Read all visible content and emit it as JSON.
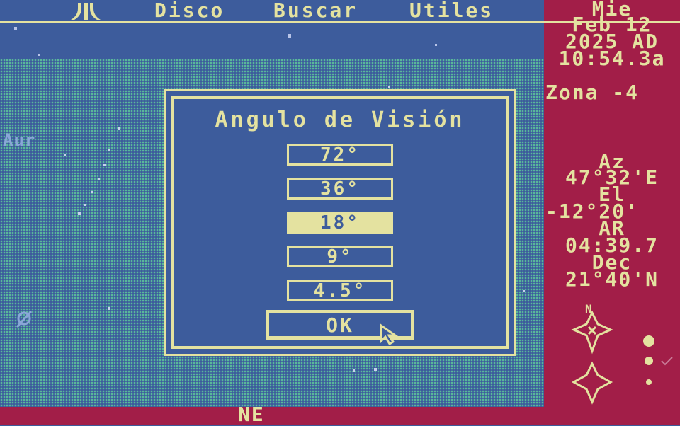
{
  "menubar": {
    "logo_icon": "atari-fuji-icon",
    "items": [
      "Disco",
      "Buscar",
      "Utiles"
    ]
  },
  "sidebar": {
    "weekday": "Mie",
    "date": "Feb 12",
    "year": "2025 AD",
    "time": "10:54.3a",
    "zone": "Zona -4",
    "az_label": "Az",
    "az_value": "47°32'E",
    "el_label": "El",
    "el_value": "-12°20'",
    "ar_label": "AR",
    "ar_value": "04:39.7",
    "dec_label": "Dec",
    "dec_value": "21°40'N",
    "compass_label": "N"
  },
  "sky": {
    "constellation_label": "Aur"
  },
  "dialog": {
    "title": "Angulo de Visión",
    "options": [
      "72°",
      "36°",
      "18°",
      "9°",
      "4.5°"
    ],
    "selected_index": 2,
    "ok_label": "OK"
  },
  "bottom": {
    "direction": "NE"
  },
  "colors": {
    "sky": "#3d5c9c",
    "panel": "#a21e48",
    "text": "#e4e2a0",
    "grid": "#59b89a"
  }
}
